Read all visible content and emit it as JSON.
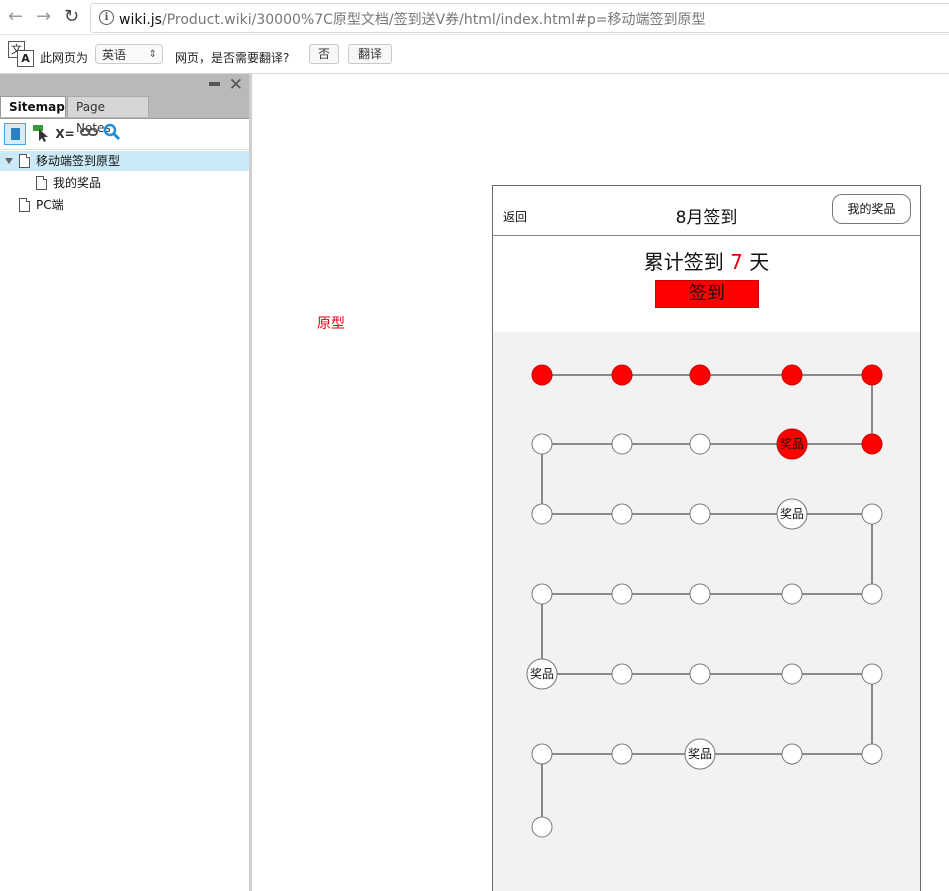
{
  "browser": {
    "url_host": "wiki.js",
    "url_path": "/Product.wiki/30000%7C原型文档/签到送V券/html/index.html#p=移动端签到原型"
  },
  "translate_bar": {
    "label": "此网页为",
    "language": "英语",
    "question": "网页，是否需要翻译?",
    "no_label": "否",
    "translate_label": "翻译"
  },
  "sitemap_panel": {
    "tabs": [
      "Sitemap",
      "Page Notes"
    ],
    "toolbar_var_label": "X=",
    "tree": [
      {
        "label": "移动端签到原型",
        "level": 0,
        "expanded": true,
        "selected": true
      },
      {
        "label": "我的奖品",
        "level": 1,
        "expanded": false,
        "selected": false
      },
      {
        "label": "PC端",
        "level": 0,
        "expanded": false,
        "selected": false
      }
    ]
  },
  "canvas": {
    "tag": "原型"
  },
  "prototype": {
    "back_label": "返回",
    "title": "8月签到",
    "my_prizes_button": "我的奖品",
    "count_prefix": "累计签到",
    "count_value": "7",
    "count_suffix": "天",
    "sign_button": "签到",
    "prize_label": "奖品",
    "active_color": "#ff0000",
    "board": {
      "rows": [
        [
          {
            "state": "checked"
          },
          {
            "state": "checked"
          },
          {
            "state": "checked"
          },
          {
            "state": "checked"
          },
          {
            "state": "checked"
          }
        ],
        [
          {
            "state": "empty"
          },
          {
            "state": "empty"
          },
          {
            "state": "empty"
          },
          {
            "state": "prize-checked"
          },
          {
            "state": "checked"
          }
        ],
        [
          {
            "state": "empty"
          },
          {
            "state": "empty"
          },
          {
            "state": "empty"
          },
          {
            "state": "prize"
          },
          {
            "state": "empty"
          }
        ],
        [
          {
            "state": "empty"
          },
          {
            "state": "empty"
          },
          {
            "state": "empty"
          },
          {
            "state": "empty"
          },
          {
            "state": "empty"
          }
        ],
        [
          {
            "state": "prize"
          },
          {
            "state": "empty"
          },
          {
            "state": "empty"
          },
          {
            "state": "empty"
          },
          {
            "state": "empty"
          }
        ],
        [
          {
            "state": "empty"
          },
          {
            "state": "empty"
          },
          {
            "state": "prize"
          },
          {
            "state": "empty"
          },
          {
            "state": "empty"
          }
        ],
        [
          {
            "state": "empty"
          }
        ]
      ]
    }
  }
}
